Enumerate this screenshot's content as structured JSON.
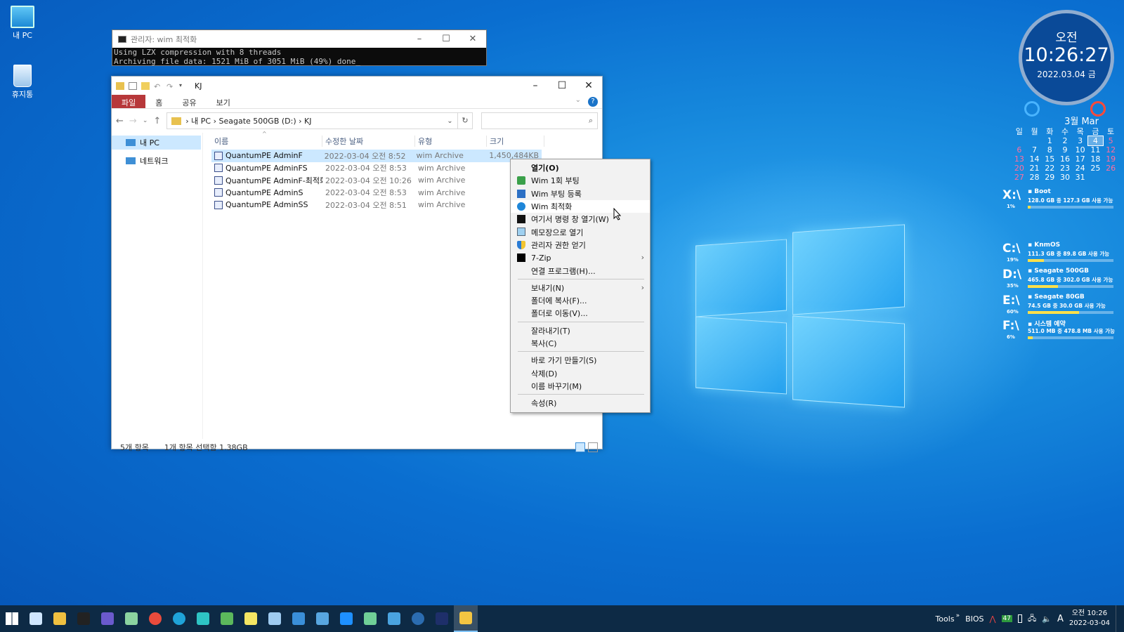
{
  "desktop": {
    "icons": [
      {
        "label": "내 PC"
      },
      {
        "label": "휴지통"
      }
    ]
  },
  "console": {
    "title": "관리자:  wim 최적화",
    "lines": [
      "Using LZX compression with 8 threads",
      "Archiving file data: 1521 MiB of 3051 MiB (49%) done_"
    ]
  },
  "explorer": {
    "title": "KJ",
    "ribbon_tabs": [
      "파일",
      "홈",
      "공유",
      "보기"
    ],
    "breadcrumb": [
      "내 PC",
      "Seagate 500GB (D:)",
      "KJ"
    ],
    "nav": [
      {
        "label": "내 PC",
        "selected": true
      },
      {
        "label": "네트워크",
        "selected": false
      }
    ],
    "columns": [
      "이름",
      "수정한 날짜",
      "유형",
      "크기"
    ],
    "files": [
      {
        "name": "QuantumPE AdminF",
        "date": "2022-03-04 오전 8:52",
        "type": "wim Archive",
        "size": "1,450,484KB",
        "selected": true
      },
      {
        "name": "QuantumPE AdminFS",
        "date": "2022-03-04 오전 8:53",
        "type": "wim Archive",
        "size": "1,",
        "selected": false
      },
      {
        "name": "QuantumPE AdminF-최적화",
        "date": "2022-03-04 오전 10:26",
        "type": "wim Archive",
        "size": "",
        "selected": false
      },
      {
        "name": "QuantumPE AdminS",
        "date": "2022-03-04 오전 8:53",
        "type": "wim Archive",
        "size": "1,",
        "selected": false
      },
      {
        "name": "QuantumPE AdminSS",
        "date": "2022-03-04 오전 8:51",
        "type": "wim Archive",
        "size": "",
        "selected": false
      }
    ],
    "status_count": "5개 항목",
    "status_selection": "1개 항목 선택함 1.38GB"
  },
  "context_menu": {
    "items": [
      {
        "label": "열기(O)",
        "bold": true,
        "icon": "",
        "submenu": false
      },
      {
        "label": "Wim 1회 부팅",
        "icon": "boot-once-icon",
        "submenu": false
      },
      {
        "label": "Wim 부팅 등록",
        "icon": "boot-register-icon",
        "submenu": false
      },
      {
        "label": "Wim 최적화",
        "icon": "optimize-icon",
        "submenu": false,
        "hover": true
      },
      {
        "label": "여기서 명령 창 열기(W)",
        "icon": "cmd-icon",
        "submenu": false
      },
      {
        "label": "메모장으로 열기",
        "icon": "notepad-icon",
        "submenu": false
      },
      {
        "label": "관리자 권한 얻기",
        "icon": "shield-icon",
        "submenu": false
      },
      {
        "label": "7-Zip",
        "icon": "7zip-icon",
        "submenu": true
      },
      {
        "label": "연결 프로그램(H)...",
        "icon": "",
        "submenu": false,
        "sep_after": true
      },
      {
        "label": "보내기(N)",
        "icon": "",
        "submenu": true
      },
      {
        "label": "폴더에 복사(F)...",
        "icon": "",
        "submenu": false
      },
      {
        "label": "폴더로 이동(V)...",
        "icon": "",
        "submenu": false,
        "sep_after": true
      },
      {
        "label": "잘라내기(T)",
        "icon": "",
        "submenu": false
      },
      {
        "label": "복사(C)",
        "icon": "",
        "submenu": false,
        "sep_after": true
      },
      {
        "label": "바로 가기 만들기(S)",
        "icon": "",
        "submenu": false
      },
      {
        "label": "삭제(D)",
        "icon": "",
        "submenu": false
      },
      {
        "label": "이름 바꾸기(M)",
        "icon": "",
        "submenu": false,
        "sep_after": true
      },
      {
        "label": "속성(R)",
        "icon": "",
        "submenu": false
      }
    ]
  },
  "clock": {
    "ampm": "오전",
    "time": "10:26:27",
    "date": "2022.03.04 금",
    "month": "3월 Mar",
    "weekdays": [
      "일",
      "월",
      "화",
      "수",
      "목",
      "금",
      "토"
    ],
    "weeks": [
      [
        "",
        "",
        "1",
        "2",
        "3",
        "4",
        "5"
      ],
      [
        "6",
        "7",
        "8",
        "9",
        "10",
        "11",
        "12"
      ],
      [
        "13",
        "14",
        "15",
        "16",
        "17",
        "18",
        "19"
      ],
      [
        "20",
        "21",
        "22",
        "23",
        "24",
        "25",
        "26"
      ],
      [
        "27",
        "28",
        "29",
        "30",
        "31",
        "",
        ""
      ]
    ],
    "today": "4"
  },
  "drives": [
    {
      "letter": "X:\\",
      "name": "Boot",
      "info": "128.0 GB 중 127.3 GB 사용 가능",
      "pct": "1%",
      "used": 0.01
    },
    {
      "letter": "C:\\",
      "name": "KnmOS",
      "info": "111.3 GB 중 89.8 GB 사용 가능",
      "pct": "19%",
      "used": 0.19
    },
    {
      "letter": "D:\\",
      "name": "Seagate 500GB",
      "info": "465.8 GB 중 302.0 GB 사용 가능",
      "pct": "35%",
      "used": 0.35
    },
    {
      "letter": "E:\\",
      "name": "Seagate 80GB",
      "info": "74.5 GB 중 30.0 GB 사용 가능",
      "pct": "60%",
      "used": 0.6
    },
    {
      "letter": "F:\\",
      "name": "시스템 예약",
      "info": "511.0 MB 중 478.8 MB 사용 가능",
      "pct": "6%",
      "used": 0.06
    }
  ],
  "taskbar": {
    "apps": [
      "start",
      "search",
      "explorer",
      "cmd",
      "floppy",
      "device",
      "chrome",
      "edge",
      "monitor",
      "calc",
      "notepad",
      "paint",
      "mail",
      "photos",
      "drop",
      "network",
      "flag",
      "power",
      "photoshop",
      "folder-active"
    ],
    "tray_tools": "Tools",
    "tray_bios": "BIOS",
    "tray_badge": "47",
    "tray_ime": "A",
    "clock_time": "오전 10:26",
    "clock_date": "2022-03-04"
  },
  "colors": {
    "file_tab": "#b7383a",
    "selection": "#cce8ff",
    "taskbar": "#0d2a45",
    "drive_bar": "#ffe04a"
  }
}
